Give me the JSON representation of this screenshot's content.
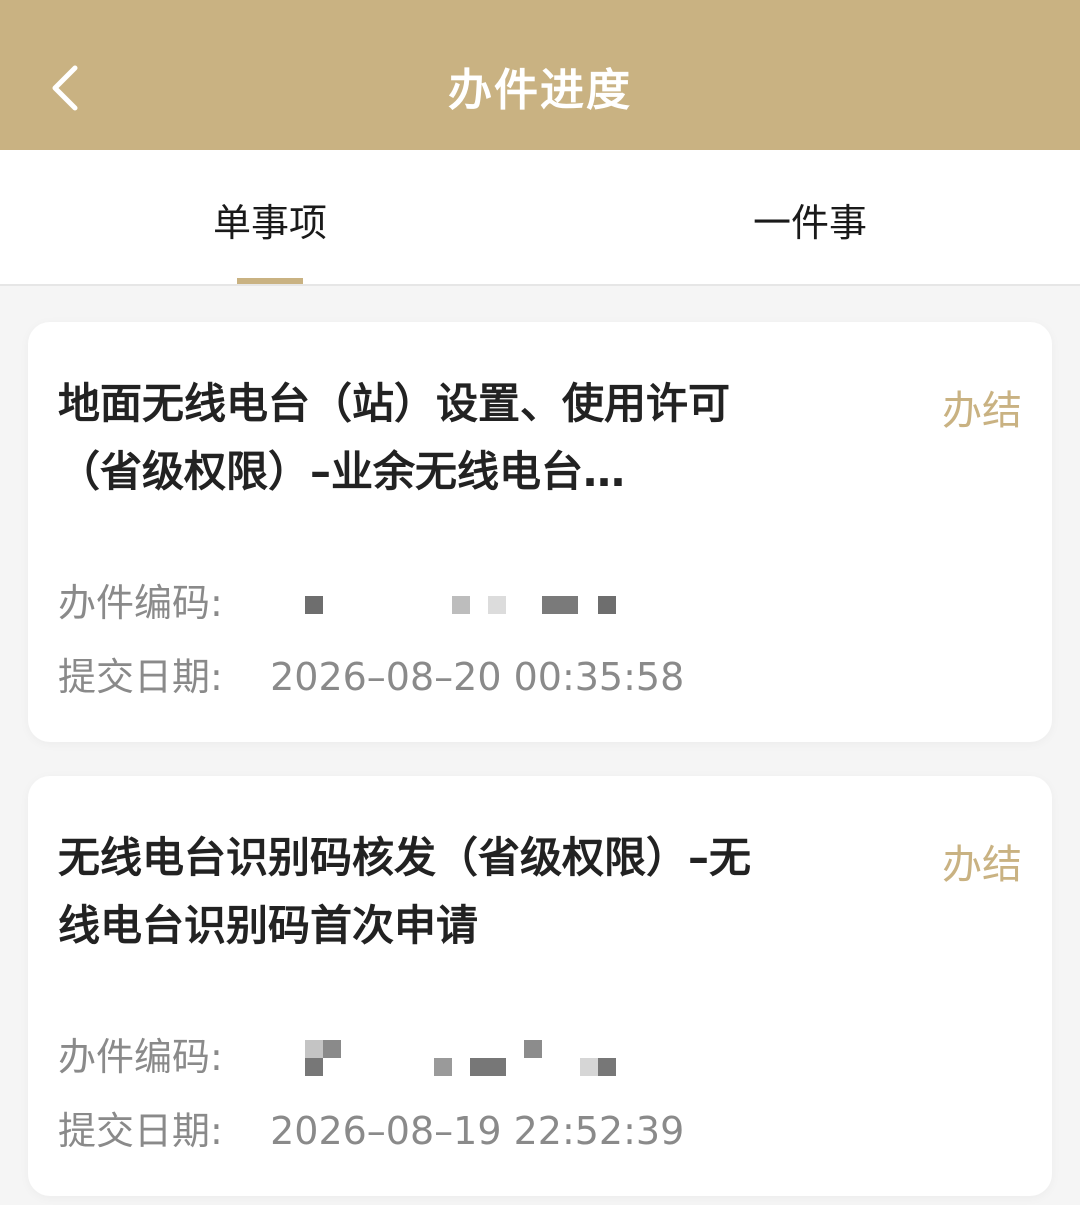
{
  "header": {
    "title": "办件进度",
    "back_icon": "chevron-left-icon",
    "background_color": "#c9b282"
  },
  "tabs": [
    {
      "label": "单事项",
      "active": true
    },
    {
      "label": "一件事",
      "active": false
    }
  ],
  "accent_color": "#c9b282",
  "cards": [
    {
      "title": "地面无线电台（站）设置、使用许可（省级权限）–业余无线电台…",
      "status": "办结",
      "code_label": "办件编码:",
      "date_label": "提交日期:",
      "date_value": "2026–08–20 00:35:58"
    },
    {
      "title": "无线电台识别码核发（省级权限）–无线电台识别码首次申请",
      "status": "办结",
      "code_label": "办件编码:",
      "date_label": "提交日期:",
      "date_value": "2026–08–19 22:52:39"
    }
  ]
}
